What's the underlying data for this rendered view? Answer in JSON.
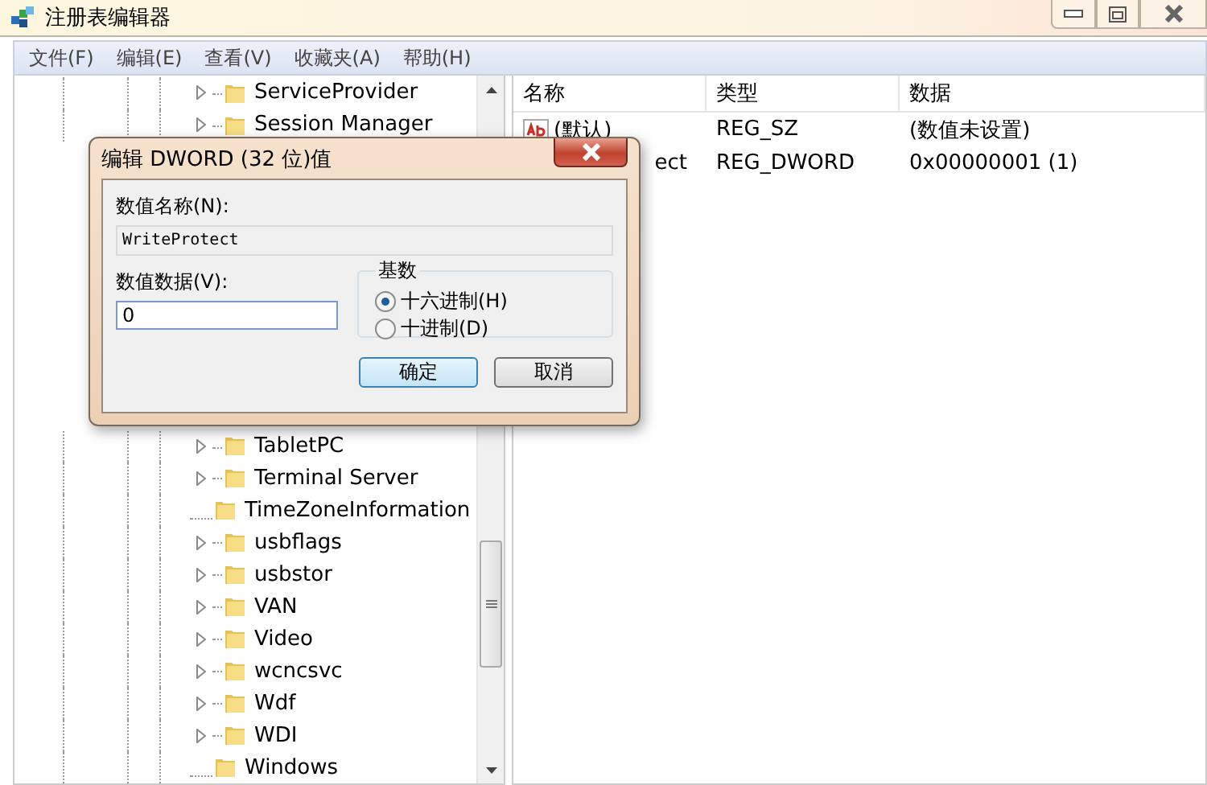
{
  "window": {
    "title": "注册表编辑器"
  },
  "menu": [
    "文件(F)",
    "编辑(E)",
    "查看(V)",
    "收藏夹(A)",
    "帮助(H)"
  ],
  "tree": {
    "items_above": [
      {
        "label": "ServiceProvider",
        "expandable": true
      },
      {
        "label": "Session Manager",
        "expandable": true
      }
    ],
    "items_below": [
      {
        "label": "TabletPC",
        "expandable": true
      },
      {
        "label": "Terminal Server",
        "expandable": true
      },
      {
        "label": "TimeZoneInformation",
        "expandable": false
      },
      {
        "label": "usbflags",
        "expandable": true
      },
      {
        "label": "usbstor",
        "expandable": true
      },
      {
        "label": "VAN",
        "expandable": true
      },
      {
        "label": "Video",
        "expandable": true
      },
      {
        "label": "wcncsvc",
        "expandable": true
      },
      {
        "label": "Wdf",
        "expandable": true
      },
      {
        "label": "WDI",
        "expandable": true
      },
      {
        "label": "Windows",
        "expandable": false
      }
    ]
  },
  "list": {
    "columns": [
      "名称",
      "类型",
      "数据"
    ],
    "rows": [
      {
        "kind": "string",
        "name": "(默认)",
        "type": "REG_SZ",
        "data": "(数值未设置)"
      },
      {
        "kind": "dword",
        "name": "ect",
        "type": "REG_DWORD",
        "data": "0x00000001 (1)"
      }
    ]
  },
  "dialog": {
    "title": "编辑 DWORD (32 位)值",
    "name_label": "数值名称(N):",
    "name_value": "WriteProtect",
    "data_label": "数值数据(V):",
    "data_value": "0",
    "base_label": "基数",
    "bases": [
      {
        "label": "十六进制(H)",
        "selected": true
      },
      {
        "label": "十进制(D)",
        "selected": false
      }
    ],
    "buttons": [
      {
        "label": "确定",
        "default": true
      },
      {
        "label": "取消",
        "default": false
      }
    ]
  }
}
